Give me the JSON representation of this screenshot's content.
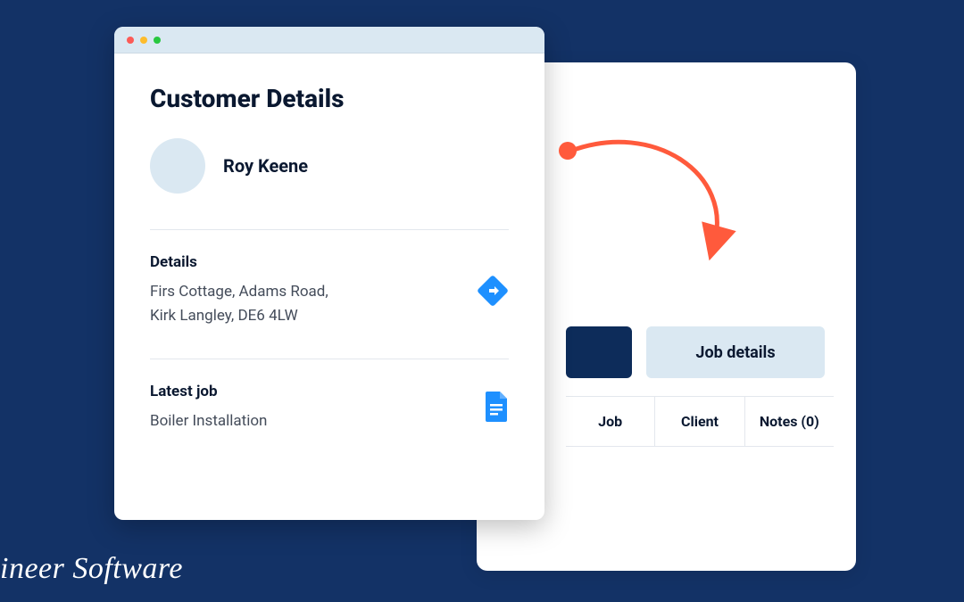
{
  "front": {
    "title": "Customer Details",
    "customer_name": "Roy Keene",
    "details": {
      "heading": "Details",
      "address_line1": "Firs Cottage, Adams Road,",
      "address_line2": "Kirk Langley, DE6 4LW"
    },
    "latest_job": {
      "heading": "Latest job",
      "value": "Boiler Installation"
    }
  },
  "back": {
    "active_tab": "Job details",
    "columns": {
      "c1": "Job",
      "c2": "Client",
      "c3": "Notes (0)"
    }
  },
  "watermark": "ineer Software",
  "colors": {
    "bg": "#133266",
    "accent_blue": "#1e90ff",
    "accent_orange": "#ff5a3c",
    "light_panel": "#dae8f2"
  }
}
